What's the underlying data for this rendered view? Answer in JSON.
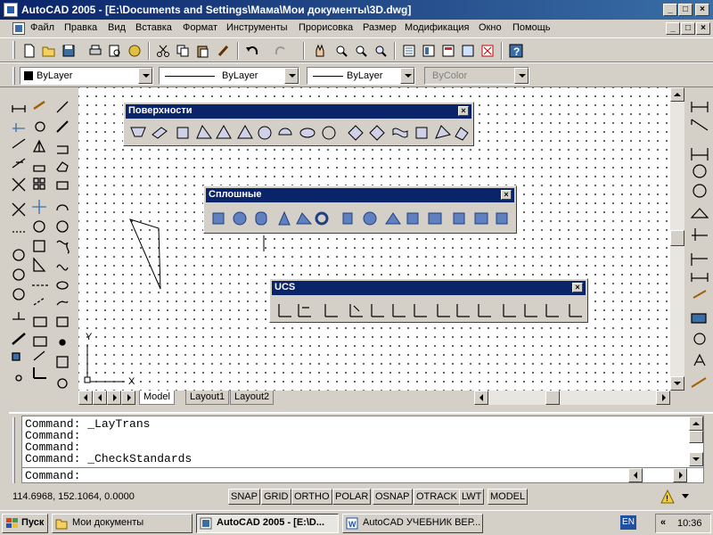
{
  "window": {
    "title": "AutoCAD 2005 - [E:\\Documents and Settings\\Мама\\Мои документы\\3D.dwg]",
    "buttons": [
      "_",
      "□",
      "×"
    ],
    "doc_buttons": [
      "_",
      "□",
      "×"
    ]
  },
  "menu": {
    "items": [
      "Файл",
      "Правка",
      "Вид",
      "Вставка",
      "Формат",
      "Инструменты",
      "Прорисовка",
      "Размер",
      "Модификация",
      "Окно",
      "Помощь"
    ]
  },
  "properties": {
    "layer": "ByLayer",
    "linetype": "ByLayer",
    "lineweight": "ByLayer",
    "plotstyle": "ByColor"
  },
  "panels": {
    "surfaces": {
      "title": "Поверхности",
      "close": "×"
    },
    "solids": {
      "title": "Сплошные",
      "close": "×"
    },
    "ucs": {
      "title": "UCS",
      "close": "×"
    }
  },
  "ucs_icon": {
    "x_label": "X",
    "y_label": "Y"
  },
  "tabs": [
    "Model",
    "Layout1",
    "Layout2"
  ],
  "nav_icons": [
    "first-tab-icon",
    "prev-tab-icon",
    "next-tab-icon",
    "last-tab-icon"
  ],
  "command": {
    "lines": [
      "Command:  _LayTrans",
      "Command:",
      "Command:",
      "Command:  _CheckStandards"
    ],
    "prompt": "Command:"
  },
  "status": {
    "coords": "114.6968, 152.1064, 0.0000",
    "toggles": [
      "SNAP",
      "GRID",
      "ORTHO",
      "POLAR",
      "OSNAP",
      "OTRACK",
      "LWT",
      "MODEL"
    ]
  },
  "taskbar": {
    "start": "Пуск",
    "tasks": [
      "Мои документы",
      "AutoCAD 2005 - [E:\\D...",
      "AutoCAD УЧЕБНИК ВЕР..."
    ],
    "lang": "EN",
    "time": "10:36"
  },
  "colors": {
    "titlebar": "#0a246a",
    "face": "#d4d0c8",
    "accent": "#3a6ea5"
  }
}
